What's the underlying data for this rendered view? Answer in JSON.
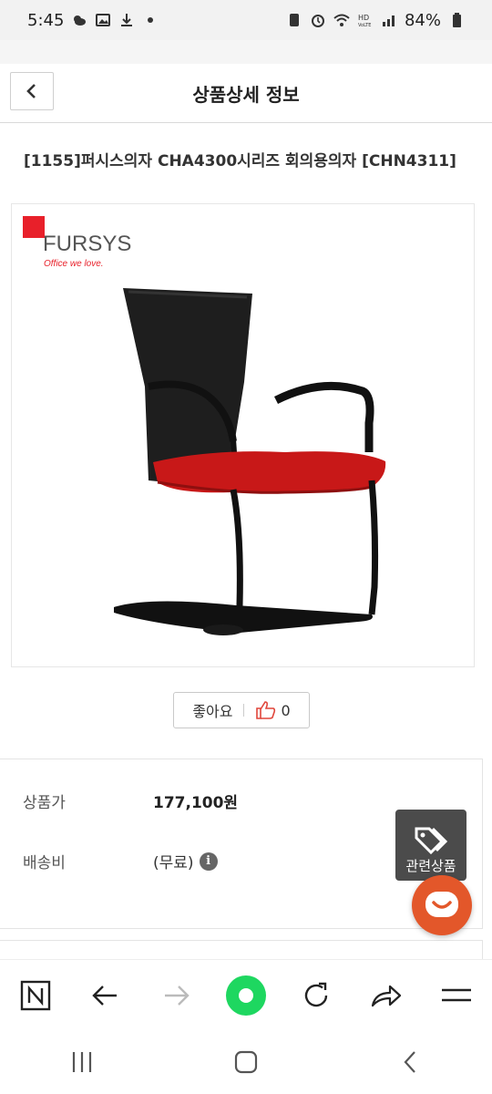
{
  "status_bar": {
    "time": "5:45",
    "battery": "84%",
    "left_icons": [
      "weather-icon",
      "gallery-icon",
      "download-icon",
      "dot-icon"
    ],
    "right_icons": [
      "nfc-icon",
      "alarm-icon",
      "wifi-icon",
      "hd-voice-icon",
      "signal-icon",
      "battery-icon"
    ]
  },
  "header": {
    "title": "상품상세 정보"
  },
  "product": {
    "title": "[1155]퍼시스의자 CHA4300시리즈 회의용의자 [CHN4311]",
    "brand_logo": "FURSYS",
    "brand_tagline": "Office we love.",
    "image_description": "black mesh meeting chair with red seat"
  },
  "like": {
    "label": "좋아요",
    "count": "0"
  },
  "info": {
    "price_label": "상품가",
    "price_value": "177,100원",
    "shipping_label": "배송비",
    "shipping_value": "(무료)"
  },
  "floating": {
    "related_label": "관련상품"
  },
  "colors": {
    "chat_button": "#e3572a",
    "related_button": "#4b4b4b",
    "nav_green": "#1ed760",
    "brand_red": "#e8202a"
  }
}
